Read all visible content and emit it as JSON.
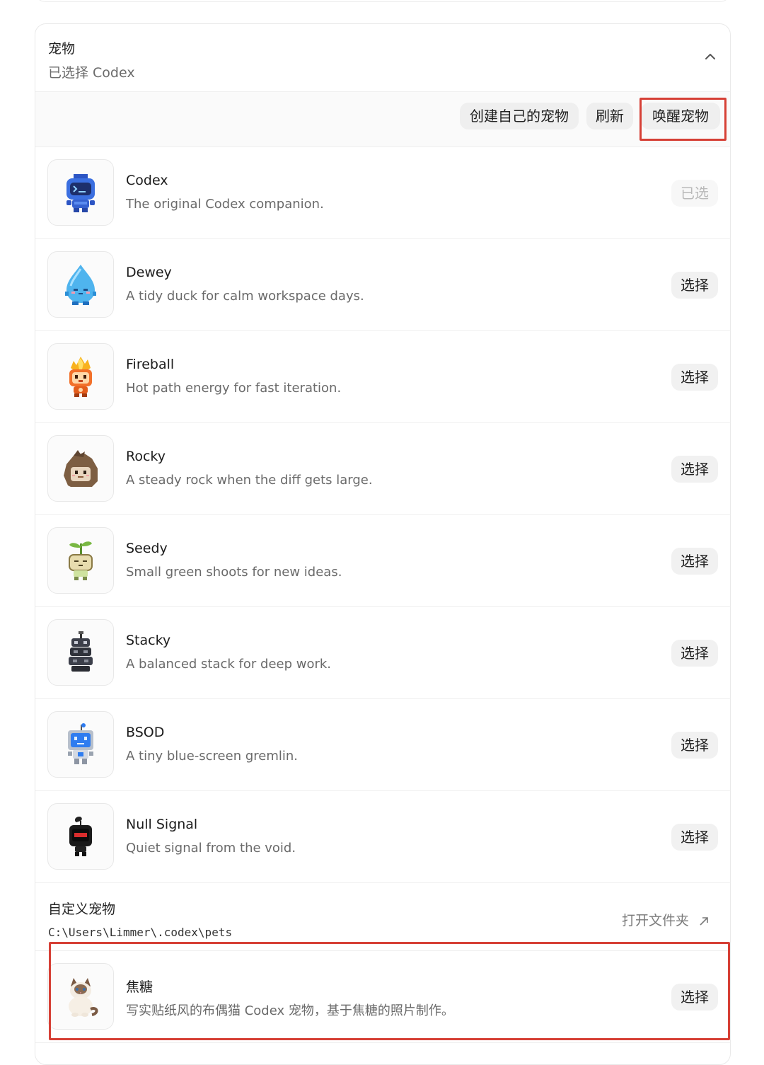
{
  "section": {
    "title": "宠物",
    "subtitle": "已选择 Codex"
  },
  "toolbar": {
    "create_label": "创建自己的宠物",
    "refresh_label": "刷新",
    "wake_label": "唤醒宠物"
  },
  "pets": [
    {
      "name": "Codex",
      "desc": "The original Codex companion.",
      "action": "已选",
      "selected": true,
      "icon": "codex-robot-icon"
    },
    {
      "name": "Dewey",
      "desc": "A tidy duck for calm workspace days.",
      "action": "选择",
      "selected": false,
      "icon": "water-drop-icon"
    },
    {
      "name": "Fireball",
      "desc": "Hot path energy for fast iteration.",
      "action": "选择",
      "selected": false,
      "icon": "fireball-icon"
    },
    {
      "name": "Rocky",
      "desc": "A steady rock when the diff gets large.",
      "action": "选择",
      "selected": false,
      "icon": "rock-icon"
    },
    {
      "name": "Seedy",
      "desc": "Small green shoots for new ideas.",
      "action": "选择",
      "selected": false,
      "icon": "sprout-icon"
    },
    {
      "name": "Stacky",
      "desc": "A balanced stack for deep work.",
      "action": "选择",
      "selected": false,
      "icon": "stack-icon"
    },
    {
      "name": "BSOD",
      "desc": "A tiny blue-screen gremlin.",
      "action": "选择",
      "selected": false,
      "icon": "blue-screen-robot-icon"
    },
    {
      "name": "Null Signal",
      "desc": "Quiet signal from the void.",
      "action": "选择",
      "selected": false,
      "icon": "null-signal-icon"
    }
  ],
  "custom": {
    "title": "自定义宠物",
    "path": "C:\\Users\\Limmer\\.codex\\pets",
    "open_folder_label": "打开文件夹",
    "pets": [
      {
        "name": "焦糖",
        "desc": "写实贴纸风的布偶猫 Codex 宠物，基于焦糖的照片制作。",
        "action": "选择",
        "icon": "ragdoll-cat-icon"
      }
    ]
  },
  "colors": {
    "highlight": "#d64036",
    "codex_blue": "#3b6fe0",
    "dewey_blue": "#4fb4ee",
    "fire_orange": "#f2702a",
    "bsod_blue": "#2e7cf0"
  }
}
